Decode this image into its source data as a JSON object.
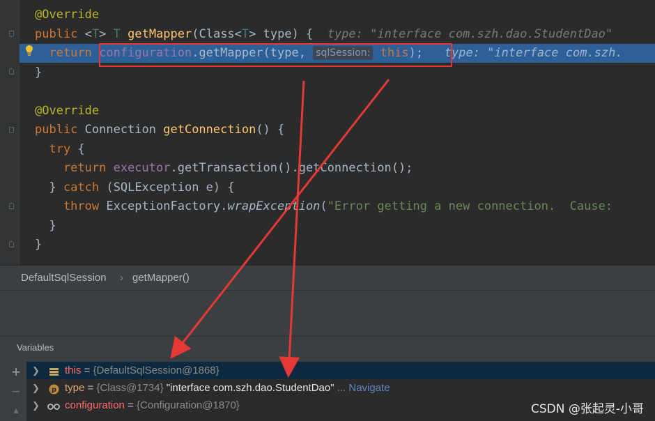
{
  "editor": {
    "lines": [
      {
        "parts": [
          {
            "t": "@Override",
            "c": "ann"
          }
        ]
      },
      {
        "parts": [
          {
            "t": "public ",
            "c": "kw"
          },
          {
            "t": "<",
            "c": ""
          },
          {
            "t": "T",
            "c": "tp"
          },
          {
            "t": "> ",
            "c": ""
          },
          {
            "t": "T ",
            "c": "tp"
          },
          {
            "t": "getMapper",
            "c": "fn"
          },
          {
            "t": "(Class<",
            "c": ""
          },
          {
            "t": "T",
            "c": "tp"
          },
          {
            "t": "> type) {  ",
            "c": ""
          },
          {
            "t": "type: \"interface com.szh.dao.StudentDao\"",
            "c": "hint"
          }
        ]
      },
      {
        "parts": [
          {
            "t": "  return ",
            "c": "kw"
          },
          {
            "t": "configuration",
            "c": "field"
          },
          {
            "t": ".getMapper(type, ",
            "c": ""
          },
          {
            "t": "sqlSession:",
            "c": "param-hint"
          },
          {
            "t": " this",
            "c": "kw"
          },
          {
            "t": ");  ",
            "c": ""
          },
          {
            "t": " type: \"interface com.szh.",
            "c": "hint-in"
          }
        ],
        "highlight": true
      },
      {
        "parts": [
          {
            "t": "}",
            "c": ""
          }
        ]
      },
      {
        "parts": []
      },
      {
        "parts": [
          {
            "t": "@Override",
            "c": "ann"
          }
        ]
      },
      {
        "parts": [
          {
            "t": "public ",
            "c": "kw"
          },
          {
            "t": "Connection ",
            "c": ""
          },
          {
            "t": "getConnection",
            "c": "fn"
          },
          {
            "t": "() {",
            "c": ""
          }
        ]
      },
      {
        "parts": [
          {
            "t": "  try ",
            "c": "kw"
          },
          {
            "t": "{",
            "c": ""
          }
        ]
      },
      {
        "parts": [
          {
            "t": "    return ",
            "c": "kw"
          },
          {
            "t": "executor",
            "c": "field"
          },
          {
            "t": ".getTransaction().getConnection();",
            "c": ""
          }
        ]
      },
      {
        "parts": [
          {
            "t": "  } ",
            "c": ""
          },
          {
            "t": "catch ",
            "c": "kw"
          },
          {
            "t": "(SQLException e) {",
            "c": ""
          }
        ]
      },
      {
        "parts": [
          {
            "t": "    throw ",
            "c": "kw"
          },
          {
            "t": "ExceptionFactory.",
            "c": ""
          },
          {
            "t": "wrapException",
            "c": "it"
          },
          {
            "t": "(",
            "c": ""
          },
          {
            "t": "\"Error getting a new connection.  Cause: ",
            "c": "str"
          }
        ]
      },
      {
        "parts": [
          {
            "t": "  }",
            "c": ""
          }
        ]
      },
      {
        "parts": [
          {
            "t": "}",
            "c": ""
          }
        ]
      }
    ]
  },
  "breadcrumb": {
    "class_name": "DefaultSqlSession",
    "separator": "›",
    "method_name": "getMapper()"
  },
  "variables": {
    "title": "Variables",
    "toolbar": {
      "add": "+",
      "remove": "−"
    },
    "rows": [
      {
        "name": "this",
        "eq": " = ",
        "value": "{DefaultSqlSession@1868}",
        "extra": "",
        "link": "",
        "icon": "field-icon"
      },
      {
        "name": "type",
        "eq": " = ",
        "value": "{Class@1734}",
        "extra": " \"interface com.szh.dao.StudentDao\"",
        "link": " ... Navigate",
        "icon": "parameter-icon"
      },
      {
        "name": "configuration",
        "eq": " = ",
        "value": "{Configuration@1870}",
        "extra": "",
        "link": "",
        "icon": "watch-icon"
      }
    ]
  },
  "watermark": "CSDN @张起灵-小哥",
  "colors": {
    "highlight": "#2d6099",
    "annotation_red": "#e53935"
  }
}
